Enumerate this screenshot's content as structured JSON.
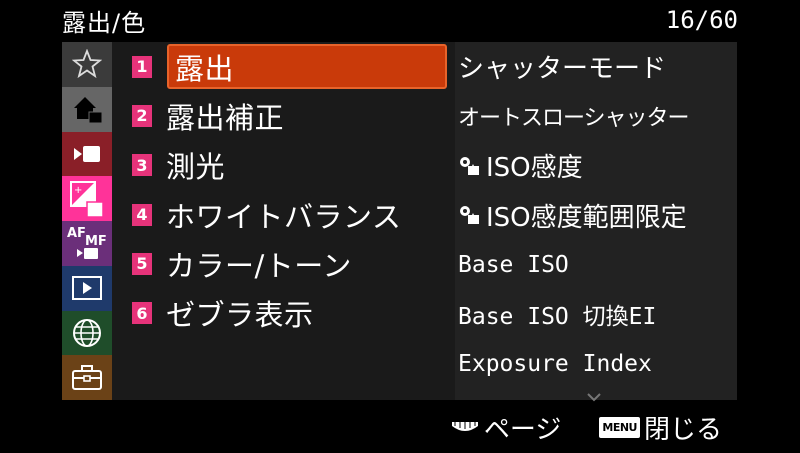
{
  "header": {
    "title": "露出/色",
    "page": "16/60"
  },
  "sidebar": {
    "tabs": [
      {
        "name": "star",
        "icon": "star-icon"
      },
      {
        "name": "home",
        "icon": "home-icon"
      },
      {
        "name": "movie",
        "icon": "movie-camera-icon"
      },
      {
        "name": "exposure-color",
        "icon": "exposure-color-icon",
        "selected": true
      },
      {
        "name": "af-mf",
        "icon": "af-mf-icon",
        "text1": "AF",
        "text2": "MF"
      },
      {
        "name": "playback",
        "icon": "playback-icon"
      },
      {
        "name": "network",
        "icon": "globe-icon"
      },
      {
        "name": "setup",
        "icon": "toolbox-icon"
      }
    ]
  },
  "items": [
    {
      "num": "1",
      "label": "露出",
      "selected": true
    },
    {
      "num": "2",
      "label": "露出補正"
    },
    {
      "num": "3",
      "label": "測光"
    },
    {
      "num": "4",
      "label": "ホワイトバランス"
    },
    {
      "num": "5",
      "label": "カラー/トーン"
    },
    {
      "num": "6",
      "label": "ゼブラ表示"
    }
  ],
  "sub_items": [
    {
      "label": "シャッターモード"
    },
    {
      "label": "オートスローシャッター"
    },
    {
      "label": "ISO感度",
      "icon": "camera-mode-icon"
    },
    {
      "label": "ISO感度範囲限定",
      "icon": "camera-mode-icon"
    },
    {
      "label": "Base ISO"
    },
    {
      "label": "Base ISO 切換EI"
    },
    {
      "label": "Exposure Index"
    }
  ],
  "footer": {
    "page_label": "ページ",
    "menu_key": "MENU",
    "close_label": "閉じる"
  },
  "colors": {
    "selected_item": "#c93a0a",
    "selected_tab": "#ff3399",
    "number_badge": "#e6337a"
  }
}
